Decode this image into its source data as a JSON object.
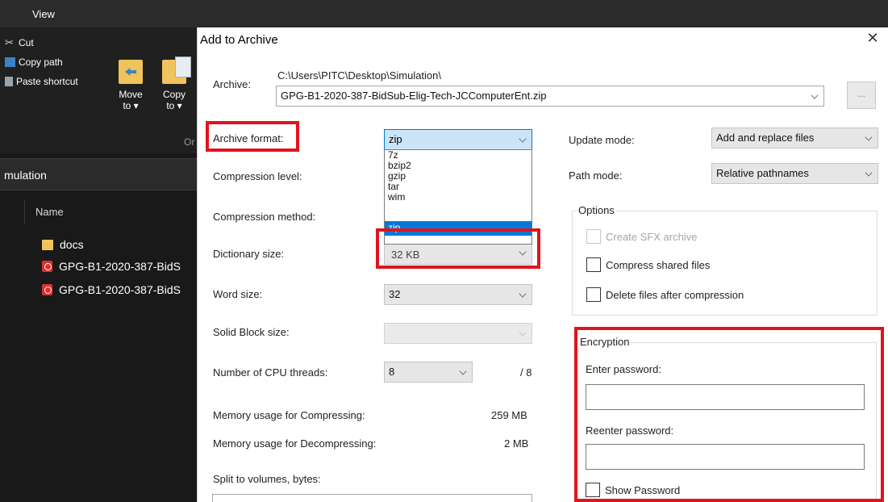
{
  "explorer": {
    "tab_view": "View",
    "ribbon": {
      "cut": "Cut",
      "copy_path": "Copy path",
      "paste_shortcut": "Paste shortcut",
      "move_to_line1": "Move",
      "move_to_line2": "to ▾",
      "copy_to_line1": "Copy",
      "copy_to_line2": "to ▾",
      "group_label_fragment": "Or"
    },
    "address_fragment": "mulation",
    "column_name": "Name",
    "files": [
      {
        "name": "docs",
        "icon": "folder-icon"
      },
      {
        "name": "GPG-B1-2020-387-BidS",
        "icon": "pdf-icon"
      },
      {
        "name": "GPG-B1-2020-387-BidS",
        "icon": "pdf-icon"
      }
    ]
  },
  "dialog": {
    "title": "Add to Archive",
    "close_glyph": "✕",
    "archive_label": "Archive:",
    "archive_path": "C:\\Users\\PITC\\Desktop\\Simulation\\",
    "archive_name": "GPG-B1-2020-387-BidSub-Elig-Tech-JCComputerEnt.zip",
    "browse_label": "...",
    "archive_format_label": "Archive format:",
    "archive_format_value": "zip",
    "archive_format_options": [
      "7z",
      "bzip2",
      "gzip",
      "tar",
      "wim",
      "zip"
    ],
    "compression_level_label": "Compression level:",
    "compression_method_label": "Compression method:",
    "dictionary_size_label": "Dictionary size:",
    "dictionary_size_value_partial": "32 KB",
    "word_size_label": "Word size:",
    "word_size_value": "32",
    "solid_block_label": "Solid Block size:",
    "cpu_threads_label": "Number of CPU threads:",
    "cpu_threads_value": "8",
    "cpu_threads_max": "/ 8",
    "mem_compress_label": "Memory usage for Compressing:",
    "mem_compress_value": "259 MB",
    "mem_decompress_label": "Memory usage for Decompressing:",
    "mem_decompress_value": "2 MB",
    "split_label": "Split to volumes, bytes:",
    "update_mode_label": "Update mode:",
    "update_mode_value": "Add and replace files",
    "path_mode_label": "Path mode:",
    "path_mode_value": "Relative pathnames",
    "options_title": "Options",
    "opt_sfx": "Create SFX archive",
    "opt_shared": "Compress shared files",
    "opt_delete": "Delete files after compression",
    "encryption_title": "Encryption",
    "enter_password_label": "Enter password:",
    "reenter_password_label": "Reenter password:",
    "show_password_label": "Show Password"
  },
  "colors": {
    "highlight_red": "#e0141e",
    "selection_blue": "#0078d7",
    "explorer_bg": "#191919"
  }
}
